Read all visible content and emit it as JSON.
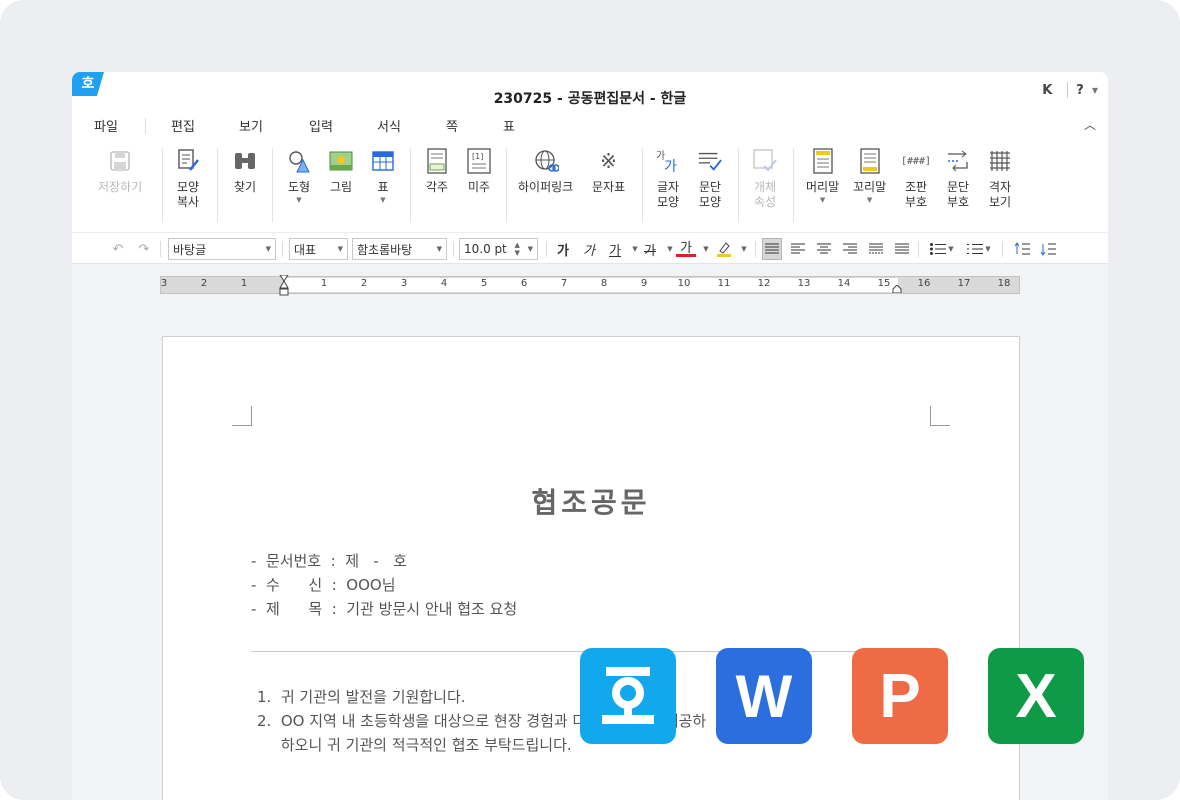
{
  "window": {
    "title": "230725 - 공동편집문서 - 한글",
    "logo_glyph": "호",
    "user_initial": "K",
    "help": "?"
  },
  "menu": [
    "파일",
    "편집",
    "보기",
    "입력",
    "서식",
    "쪽",
    "표"
  ],
  "ribbon": [
    {
      "label1": "저장하기",
      "label2": "",
      "icon": "save-icon",
      "disabled": true
    },
    {
      "label1": "모양",
      "label2": "복사",
      "icon": "format-painter-icon"
    },
    {
      "label1": "찾기",
      "label2": "",
      "icon": "binoculars-icon"
    },
    {
      "label1": "도형",
      "label2": "",
      "icon": "shapes-icon",
      "dropdown": true
    },
    {
      "label1": "그림",
      "label2": "",
      "icon": "picture-icon"
    },
    {
      "label1": "표",
      "label2": "",
      "icon": "table-icon",
      "dropdown": true
    },
    {
      "label1": "각주",
      "label2": "",
      "icon": "footnote-icon"
    },
    {
      "label1": "미주",
      "label2": "",
      "icon": "endnote-icon"
    },
    {
      "label1": "하이퍼링크",
      "label2": "",
      "icon": "hyperlink-icon"
    },
    {
      "label1": "문자표",
      "label2": "",
      "icon": "symbol-icon"
    },
    {
      "label1": "글자",
      "label2": "모양",
      "icon": "char-shape-icon"
    },
    {
      "label1": "문단",
      "label2": "모양",
      "icon": "para-shape-icon"
    },
    {
      "label1": "개체",
      "label2": "속성",
      "icon": "object-props-icon",
      "disabled": true
    },
    {
      "label1": "머리말",
      "label2": "",
      "icon": "header-icon",
      "dropdown": true
    },
    {
      "label1": "꼬리말",
      "label2": "",
      "icon": "footer-icon",
      "dropdown": true
    },
    {
      "label1": "조판",
      "label2": "부호",
      "icon": "layout-code-icon"
    },
    {
      "label1": "문단",
      "label2": "부호",
      "icon": "para-mark-icon"
    },
    {
      "label1": "격자",
      "label2": "보기",
      "icon": "grid-icon"
    }
  ],
  "format": {
    "style": "바탕글",
    "lang": "대표",
    "font": "함초롬바탕",
    "size": "10.0",
    "unit": "pt",
    "bold_glyph": "가",
    "italic_glyph": "가",
    "underline_glyph": "가",
    "strike_glyph": "가",
    "color_glyph": "가",
    "text_color": "#e02020",
    "highlight_color": "#f3c623"
  },
  "ruler": {
    "left_numbers": [
      "3",
      "2",
      "1"
    ],
    "right_numbers": [
      "1",
      "2",
      "3",
      "4",
      "5",
      "6",
      "7",
      "8",
      "9",
      "10",
      "11",
      "12",
      "13",
      "14",
      "15",
      "16",
      "17",
      "18"
    ]
  },
  "document": {
    "title": "협조공문",
    "meta": [
      "-  문서번호  :  제   -   호",
      "-  수      신  :  OOO님",
      "-  제      목  :  기관 방문시 안내 협조 요청"
    ],
    "body": [
      "1.  귀 기관의 발전을 기원합니다.",
      "2.  OO 지역 내 초등학생을 대상으로 현장 경험과 다양한 정보를 제공하",
      "     하오니 귀 기관의 적극적인 협조 부탁드립니다."
    ]
  },
  "badges": {
    "hwp": "호",
    "word": "W",
    "ppt": "P",
    "excel": "X"
  },
  "colors": {
    "hwp": "#12a8ee",
    "word": "#2b6fde",
    "ppt": "#ee6b45",
    "excel": "#0f9a47"
  }
}
